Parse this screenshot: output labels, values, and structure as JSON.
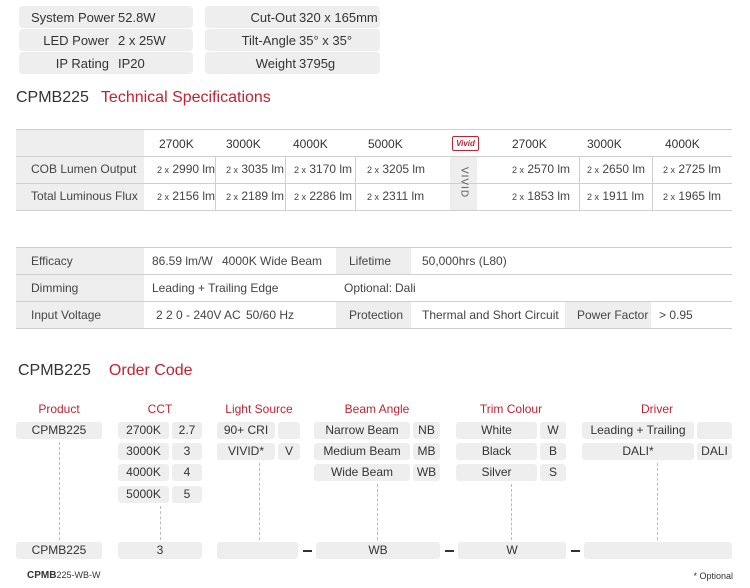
{
  "summary": {
    "system_power_label": "System Power",
    "system_power_value": "52.8W",
    "led_power_label": "LED Power",
    "led_power_value": "2 x 25W",
    "ip_rating_label": "IP Rating",
    "ip_rating_value": "IP20",
    "cutout_label": "Cut-Out",
    "cutout_value": "320 x 165mm",
    "tilt_label": "Tilt-Angle",
    "tilt_value": "35° x 35°",
    "weight_label": "Weight",
    "weight_value": "3795g"
  },
  "tech": {
    "model": "CPMB225",
    "title": "Technical Specifications",
    "vivid_logo": "Vivid",
    "vivid_vertical": "VIVID",
    "temps": [
      "2700K",
      "3000K",
      "4000K",
      "5000K"
    ],
    "vivid_temps": [
      "2700K",
      "3000K",
      "4000K"
    ],
    "mult": "2 x",
    "rows": [
      {
        "label": "COB Lumen Output",
        "values": [
          "2990 lm",
          "3035 lm",
          "3170 lm",
          "3205 lm"
        ],
        "vivid": [
          "2570 lm",
          "2650 lm",
          "2725 lm"
        ]
      },
      {
        "label": "Total Luminous Flux",
        "values": [
          "2156 lm",
          "2189 lm",
          "2286 lm",
          "2311 lm"
        ],
        "vivid": [
          "1853 lm",
          "1911 lm",
          "1965 lm"
        ]
      }
    ]
  },
  "specs": {
    "efficacy_label": "Efficacy",
    "efficacy_value": "86.59 lm/W",
    "efficacy_note": "4000K Wide Beam",
    "lifetime_label": "Lifetime",
    "lifetime_value": "50,000hrs (L80)",
    "dimming_label": "Dimming",
    "dimming_value": "Leading + Trailing Edge",
    "optional_label": "Optional:",
    "optional_value": "Dali",
    "input_label": "Input Voltage",
    "input_value": "2 2 0 - 240V AC",
    "input_freq": "50/60 Hz",
    "protection_label": "Protection",
    "protection_value": "Thermal and Short Circuit",
    "pf_label": "Power Factor",
    "pf_value": "> 0.95"
  },
  "order": {
    "model": "CPMB225",
    "title": "Order Code",
    "headers": {
      "product": "Product",
      "cct": "CCT",
      "light": "Light Source",
      "beam": "Beam Angle",
      "trim": "Trim Colour",
      "driver": "Driver"
    },
    "product": "CPMB225",
    "cct": [
      [
        "2700K",
        "2.7"
      ],
      [
        "3000K",
        "3"
      ],
      [
        "4000K",
        "4"
      ],
      [
        "5000K",
        "5"
      ]
    ],
    "light": [
      [
        "90+ CRI",
        ""
      ],
      [
        "VIVID*",
        "V"
      ]
    ],
    "beam": [
      [
        "Narrow Beam",
        "NB"
      ],
      [
        "Medium Beam",
        "MB"
      ],
      [
        "Wide Beam",
        "WB"
      ]
    ],
    "trim": [
      [
        "White",
        "W"
      ],
      [
        "Black",
        "B"
      ],
      [
        "Silver",
        "S"
      ]
    ],
    "driver": [
      [
        "Leading + Trailing",
        ""
      ],
      [
        "DALI*",
        "DALI"
      ]
    ],
    "result": {
      "product": "CPMB225",
      "cct": "3",
      "light": "",
      "beam": "WB",
      "trim": "W",
      "driver": ""
    },
    "example_bold": "CPMB",
    "example_rest": "225-WB-W",
    "optional_note": "* Optional"
  },
  "colors": {
    "accent": "#c8202f",
    "panel": "#eeeeee"
  }
}
